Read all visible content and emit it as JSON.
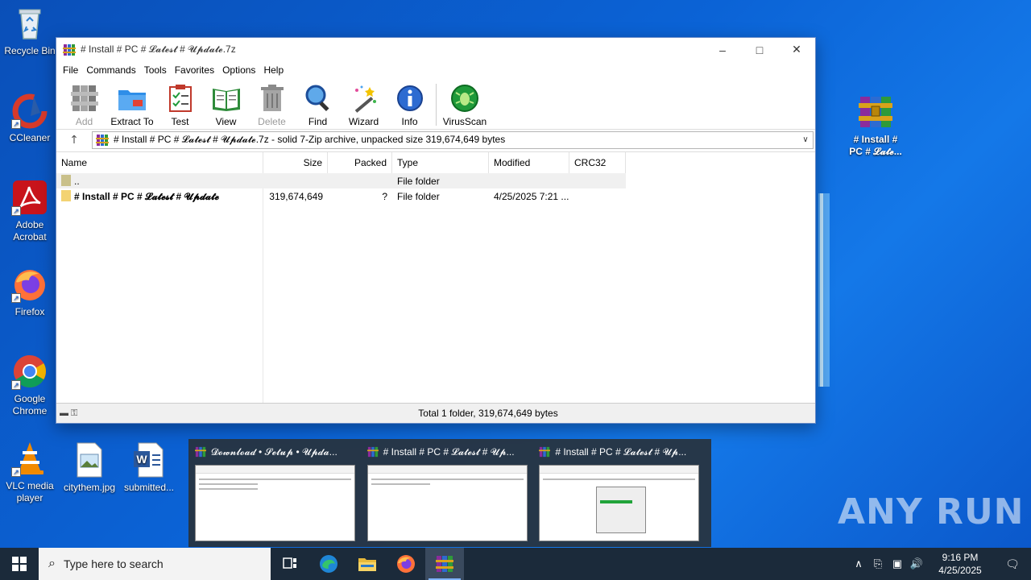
{
  "desktop": {
    "icons": [
      {
        "label": "Recycle Bin",
        "icon": "recycle-bin-icon"
      },
      {
        "label": "CCleaner",
        "icon": "ccleaner-icon"
      },
      {
        "label": "Adobe Acrobat",
        "icon": "adobe-acrobat-icon"
      },
      {
        "label": "Firefox",
        "icon": "firefox-icon"
      },
      {
        "label": "Google Chrome",
        "icon": "chrome-icon"
      },
      {
        "label": "VLC media player",
        "icon": "vlc-icon"
      },
      {
        "label": "citythem.jpg",
        "icon": "image-file-icon"
      },
      {
        "label": "submitted...",
        "icon": "word-document-icon"
      },
      {
        "label": "# Install # PC # 𝓛𝓪𝓽𝓮...",
        "icon": "winrar-archive-icon"
      }
    ]
  },
  "window": {
    "title": "# Install # PC # 𝓛𝓪𝓽𝓮𝓼𝓽 # 𝓤𝓹𝓭𝓪𝓽𝓮.7z",
    "menu": [
      "File",
      "Commands",
      "Tools",
      "Favorites",
      "Options",
      "Help"
    ],
    "toolbar": [
      {
        "label": "Add",
        "icon": "add-icon",
        "disabled": true
      },
      {
        "label": "Extract To",
        "icon": "extract-to-icon",
        "disabled": false
      },
      {
        "label": "Test",
        "icon": "test-icon",
        "disabled": false
      },
      {
        "label": "View",
        "icon": "view-icon",
        "disabled": false
      },
      {
        "label": "Delete",
        "icon": "delete-icon",
        "disabled": true
      },
      {
        "label": "Find",
        "icon": "find-icon",
        "disabled": false
      },
      {
        "label": "Wizard",
        "icon": "wizard-icon",
        "disabled": false
      },
      {
        "label": "Info",
        "icon": "info-icon",
        "disabled": false
      },
      {
        "label": "VirusScan",
        "icon": "virusscan-icon",
        "disabled": false
      }
    ],
    "address": "# Install # PC # 𝓛𝓪𝓽𝓮𝓼𝓽 # 𝓤𝓹𝓭𝓪𝓽𝓮.7z - solid 7-Zip archive, unpacked size 319,674,649 bytes",
    "columns": [
      "Name",
      "Size",
      "Packed",
      "Type",
      "Modified",
      "CRC32"
    ],
    "rows": [
      {
        "name": "..",
        "size": "",
        "packed": "",
        "type": "File folder",
        "modified": "",
        "crc": ""
      },
      {
        "name": "# Install # PC # 𝓛𝓪𝓽𝓮𝓼𝓽 # 𝓤𝓹𝓭𝓪𝓽𝓮",
        "size": "319,674,649",
        "packed": "?",
        "type": "File folder",
        "modified": "4/25/2025 7:21 ...",
        "crc": ""
      }
    ],
    "status": "Total 1 folder, 319,674,649 bytes"
  },
  "thumbnails": [
    {
      "title": "𝓓𝓸𝔀𝓷𝓵𝓸𝓪𝓭 • 𝓢𝓮𝓽𝓾𝓹 • 𝓤𝓹𝓭𝓪..."
    },
    {
      "title": "# Install # PC # 𝓛𝓪𝓽𝓮𝓼𝓽 # 𝓤𝓹..."
    },
    {
      "title": "# Install # PC # 𝓛𝓪𝓽𝓮𝓼𝓽 # 𝓤𝓹..."
    }
  ],
  "watermark": "ANY RUN",
  "taskbar": {
    "search_placeholder": "Type here to search",
    "time": "9:16 PM",
    "date": "4/25/2025"
  }
}
